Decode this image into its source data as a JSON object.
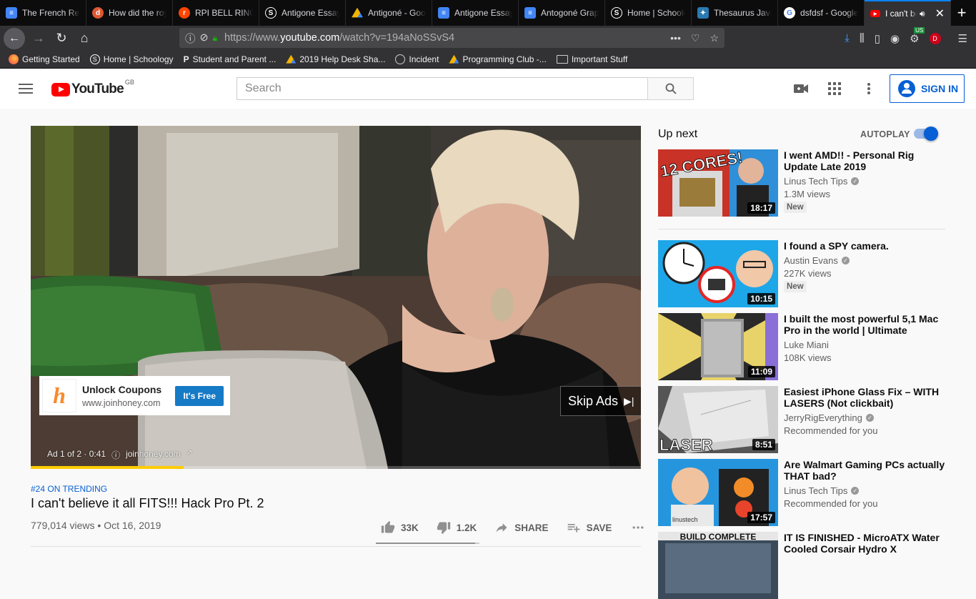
{
  "browser": {
    "tabs": [
      {
        "title": "The French Revolution",
        "icon": "docs-icon",
        "color": "#4285f4"
      },
      {
        "title": "How did the royal",
        "icon": "duckduckgo-icon",
        "color": "#de5833"
      },
      {
        "title": "RPI BELL RINGER",
        "icon": "reddit-icon",
        "color": "#ff4500"
      },
      {
        "title": "Antigone Essay",
        "icon": "schoology-icon",
        "color": "#1c1c1c"
      },
      {
        "title": "Antigoné - Google",
        "icon": "drive-icon",
        "color": "#f4b400"
      },
      {
        "title": "Antigone Essay",
        "icon": "docs-icon",
        "color": "#4285f4"
      },
      {
        "title": "Antogoné Graphic",
        "icon": "docs-icon",
        "color": "#4285f4"
      },
      {
        "title": "Home | Schoology",
        "icon": "schoology-icon",
        "color": "#1c1c1c"
      },
      {
        "title": "Thesaurus Java",
        "icon": "puzzle-icon",
        "color": "#2a7ab0"
      },
      {
        "title": "dsfdsf - Google",
        "icon": "google-icon",
        "color": "#ffffff"
      },
      {
        "title": "I can't believe",
        "icon": "youtube-icon",
        "color": "#ff0000",
        "active": true
      }
    ],
    "url_prefix": "https://www.",
    "url_host": "youtube.com",
    "url_path": "/watch?v=194aNoSSvS4",
    "profile_letter": "D",
    "vpn_badge": "US",
    "bookmarks": [
      {
        "label": "Getting Started",
        "icon": "firefox-icon",
        "color": "#ff7139"
      },
      {
        "label": "Home | Schoology",
        "icon": "schoology-icon",
        "color": "#ffffff"
      },
      {
        "label": "Student and Parent ...",
        "icon": "p-icon",
        "color": "#eeeeee"
      },
      {
        "label": "2019 Help Desk Sha...",
        "icon": "drive-icon",
        "color": "#f4b400"
      },
      {
        "label": "Incident",
        "icon": "globe-icon",
        "color": "#cccccc"
      },
      {
        "label": "Programming Club -...",
        "icon": "drive-icon",
        "color": "#f4b400"
      },
      {
        "label": "Important Stuff",
        "icon": "folder-icon",
        "color": "#cccccc"
      }
    ]
  },
  "header": {
    "logo_text": "YouTube",
    "region": "GB",
    "search_placeholder": "Search",
    "sign_in": "SIGN IN"
  },
  "player": {
    "ad_title": "Unlock Coupons",
    "ad_url": "www.joinhoney.com",
    "ad_button": "It's Free",
    "skip_label": "Skip Ads",
    "ad_counter": "Ad 1 of 2 · 0:41",
    "ad_domain": "joinhoney.com",
    "progress_fraction": 0.25
  },
  "video": {
    "trending": "#24 ON TRENDING",
    "title": "I can't believe it all FITS!!! Hack Pro Pt. 2",
    "views": "779,014 views",
    "date": "Oct 16, 2019",
    "likes": "33K",
    "dislikes": "1.2K",
    "share": "SHARE",
    "save": "SAVE",
    "like_fraction": 0.96
  },
  "sidebar": {
    "up_next": "Up next",
    "autoplay": "AUTOPLAY",
    "autoplay_on": true,
    "recommendations": [
      {
        "title": "I went AMD!! - Personal Rig Update Late 2019",
        "channel": "Linus Tech Tips",
        "verified": true,
        "meta": "1.3M views",
        "badge": "New",
        "duration": "18:17",
        "thumb_text": "12 CORES!"
      },
      {
        "title": "I found a SPY camera.",
        "channel": "Austin Evans",
        "verified": true,
        "meta": "227K views",
        "badge": "New",
        "duration": "10:15",
        "thumb_text": ""
      },
      {
        "title": "I built the most powerful 5,1 Mac Pro in the world | Ultimate",
        "channel": "Luke Miani",
        "verified": false,
        "meta": "108K views",
        "badge": "",
        "duration": "11:09",
        "thumb_text": ""
      },
      {
        "title": "Easiest iPhone Glass Fix – WITH LASERS (Not clickbait)",
        "channel": "JerryRigEverything",
        "verified": true,
        "meta": "Recommended for you",
        "badge": "",
        "duration": "8:51",
        "thumb_text": "LASER"
      },
      {
        "title": "Are Walmart Gaming PCs actually THAT bad?",
        "channel": "Linus Tech Tips",
        "verified": true,
        "meta": "Recommended for you",
        "badge": "",
        "duration": "17:57",
        "thumb_text": "linustech"
      },
      {
        "title": "IT IS FINISHED - MicroATX Water Cooled Corsair Hydro X",
        "channel": "",
        "verified": false,
        "meta": "",
        "badge": "",
        "duration": "",
        "thumb_text": "BUILD COMPLETE"
      }
    ]
  }
}
